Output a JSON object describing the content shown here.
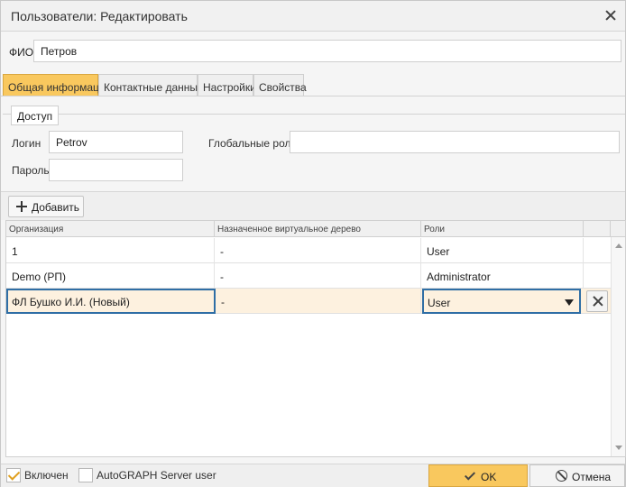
{
  "window": {
    "title": "Пользователи: Редактировать"
  },
  "fio": {
    "label": "ФИО",
    "value": "Петров"
  },
  "tabs": [
    {
      "label": "Общая информация",
      "active": true
    },
    {
      "label": "Контактные данные",
      "active": false
    },
    {
      "label": "Настройки",
      "active": false
    },
    {
      "label": "Свойства",
      "active": false
    }
  ],
  "access": {
    "legend": "Доступ",
    "login_label": "Логин",
    "login_value": "Petrov",
    "password_label": "Пароль",
    "password_value": "",
    "global_roles_label": "Глобальные роли",
    "global_roles_value": ""
  },
  "toolbar": {
    "add_label": "Добавить"
  },
  "grid": {
    "columns": [
      "Организация",
      "Назначенное виртуальное дерево",
      "Роли"
    ],
    "rows": [
      {
        "org": "1",
        "tree": "-",
        "role": "User"
      },
      {
        "org": "Demo (РП)",
        "tree": "-",
        "role": "Administrator"
      },
      {
        "org": "ФЛ Бушко И.И. (Новый)",
        "tree": "-",
        "role": "User"
      }
    ]
  },
  "footer": {
    "enabled_label": "Включен",
    "enabled_checked": true,
    "server_user_label": "AutoGRAPH Server user",
    "server_user_checked": false,
    "ok_label": "OK",
    "cancel_label": "Отмена"
  },
  "colors": {
    "accent": "#f9c85e",
    "focus": "#2f6ea5",
    "selected_row": "#fdf1df"
  }
}
